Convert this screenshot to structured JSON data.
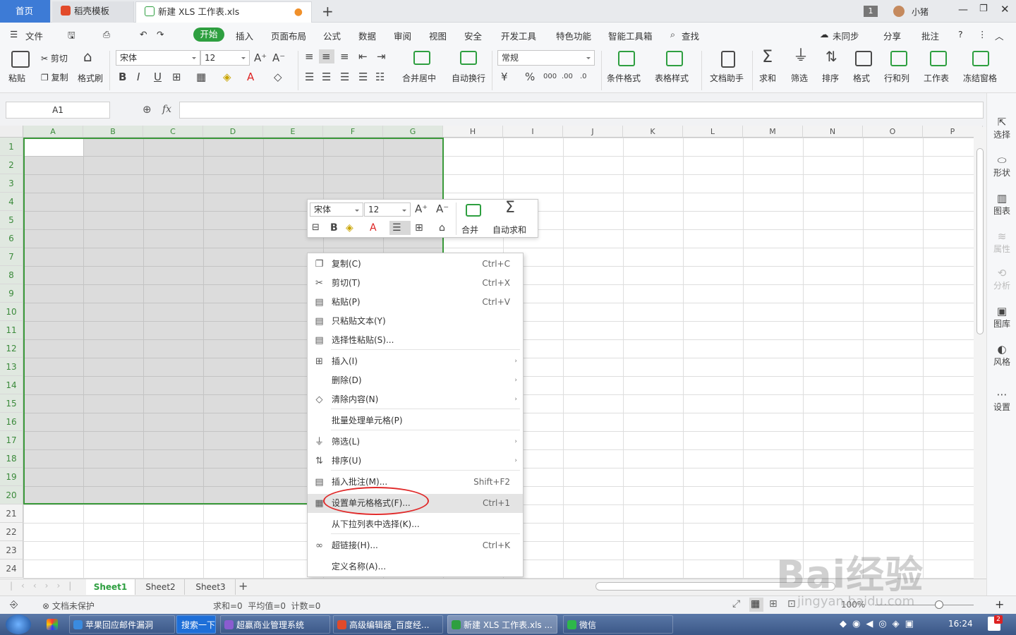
{
  "tabs": {
    "home": "首页",
    "template": "稻壳模板",
    "file": "新建 XLS 工作表.xls",
    "page_num": "1",
    "user": "小猪"
  },
  "menu": {
    "file": "文件",
    "start": "开始",
    "insert": "插入",
    "layout": "页面布局",
    "formula": "公式",
    "data": "数据",
    "review": "审阅",
    "view": "视图",
    "security": "安全",
    "dev": "开发工具",
    "special": "特色功能",
    "smart": "智能工具箱",
    "search": "查找",
    "sync": "未同步",
    "share": "分享",
    "comment": "批注"
  },
  "ribbon": {
    "paste": "粘贴",
    "cut": "剪切",
    "copy": "复制",
    "painter": "格式刷",
    "font": "宋体",
    "size": "12",
    "merge": "合并居中",
    "wrap": "自动换行",
    "numfmt": "常规",
    "cond": "条件格式",
    "tablestyle": "表格样式",
    "dochelper": "文档助手",
    "sum": "求和",
    "filter": "筛选",
    "sort": "排序",
    "format": "格式",
    "rowcol": "行和列",
    "sheet": "工作表",
    "freeze": "冻结窗格"
  },
  "formula_bar": {
    "namebox": "A1",
    "fx": "fx"
  },
  "columns": [
    "A",
    "B",
    "C",
    "D",
    "E",
    "F",
    "G",
    "H",
    "I",
    "J",
    "K",
    "L",
    "M",
    "N",
    "O",
    "P"
  ],
  "rows": [
    "1",
    "2",
    "3",
    "4",
    "5",
    "6",
    "7",
    "8",
    "9",
    "10",
    "11",
    "12",
    "13",
    "14",
    "15",
    "16",
    "17",
    "18",
    "19",
    "20",
    "21",
    "22",
    "23",
    "24"
  ],
  "right_panel": [
    "选择",
    "形状",
    "图表",
    "属性",
    "分析",
    "图库",
    "风格",
    "设置"
  ],
  "mini_toolbar": {
    "font": "宋体",
    "size": "12",
    "merge": "合并",
    "autosum": "自动求和"
  },
  "context_menu": [
    {
      "label": "复制(C)",
      "shortcut": "Ctrl+C",
      "icon": "copy-icon"
    },
    {
      "label": "剪切(T)",
      "shortcut": "Ctrl+X",
      "icon": "cut-icon"
    },
    {
      "label": "粘贴(P)",
      "shortcut": "Ctrl+V",
      "icon": "paste-icon"
    },
    {
      "label": "只粘贴文本(Y)",
      "shortcut": "",
      "icon": "paste-text-icon"
    },
    {
      "label": "选择性粘贴(S)...",
      "shortcut": "",
      "icon": "paste-special-icon"
    },
    {
      "label": "插入(I)",
      "shortcut": "",
      "icon": "insert-icon",
      "sub": true
    },
    {
      "label": "删除(D)",
      "shortcut": "",
      "icon": "",
      "sub": true
    },
    {
      "label": "清除内容(N)",
      "shortcut": "",
      "icon": "eraser-icon",
      "sub": true
    },
    {
      "label": "批量处理单元格(P)",
      "shortcut": "",
      "icon": ""
    },
    {
      "label": "筛选(L)",
      "shortcut": "",
      "icon": "filter-icon",
      "sub": true
    },
    {
      "label": "排序(U)",
      "shortcut": "",
      "icon": "sort-icon",
      "sub": true
    },
    {
      "label": "插入批注(M)...",
      "shortcut": "Shift+F2",
      "icon": "comment-icon"
    },
    {
      "label": "设置单元格格式(F)...",
      "shortcut": "Ctrl+1",
      "icon": "format-cells-icon"
    },
    {
      "label": "从下拉列表中选择(K)...",
      "shortcut": "",
      "icon": ""
    },
    {
      "label": "超链接(H)...",
      "shortcut": "Ctrl+K",
      "icon": "link-icon"
    },
    {
      "label": "定义名称(A)...",
      "shortcut": "",
      "icon": ""
    }
  ],
  "sheet_tabs": [
    "Sheet1",
    "Sheet2",
    "Sheet3"
  ],
  "status": {
    "protect": "文档未保护",
    "stats": "求和=0  平均值=0  计数=0",
    "zoom": "100%"
  },
  "taskbar": {
    "items": [
      "苹果回应邮件漏洞",
      "搜索一下",
      "超赢商业管理系统",
      "高级编辑器_百度经...",
      "新建 XLS 工作表.xls ...",
      "微信"
    ],
    "clock": "16:24",
    "badge": "2"
  },
  "watermark": {
    "brand": "Bai经验",
    "url": "jingyan.baidu.com"
  },
  "colors": {
    "accent": "#2e9f40",
    "selection_border": "#3a9a3a",
    "highlight_oval": "#e02a2a"
  }
}
